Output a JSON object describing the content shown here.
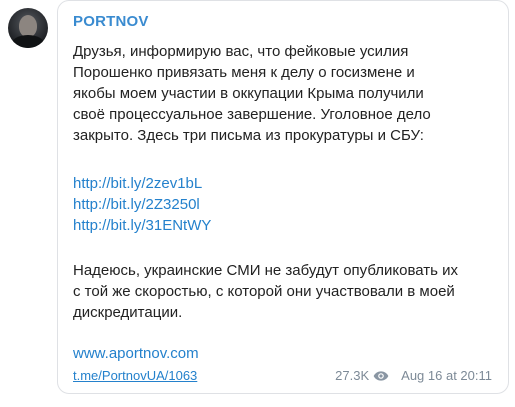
{
  "channel": {
    "name": "PORTNOV"
  },
  "message": {
    "paragraph1": [
      "Друзья, информирую вас, что фейковые усилия",
      "Порошенко привязать меня к делу о госизмене и",
      "якобы моем участии в оккупации Крыма получили",
      "своё процессуальное завершение. Уголовное дело",
      "закрыто. Здесь три письма из прокуратуры и СБУ:"
    ],
    "links": [
      "http://bit.ly/2zev1bL",
      "http://bit.ly/2Z3250l",
      "http://bit.ly/31ENtWY"
    ],
    "paragraph2": [
      "Надеюсь, украинские СМИ не забудут опубликовать их",
      "с той же скоростью, с которой они участвовали в моей",
      "дискредитации."
    ],
    "website": "www.aportnov.com"
  },
  "footer": {
    "post_link": "t.me/PortnovUA/1063",
    "views": "27.3K",
    "views_icon": "eye-icon",
    "timestamp": "Aug 16 at 20:11"
  },
  "colors": {
    "channel_name": "#3a8bd0",
    "link": "#2481cc",
    "meta": "#7d8a97",
    "text": "#222222"
  }
}
